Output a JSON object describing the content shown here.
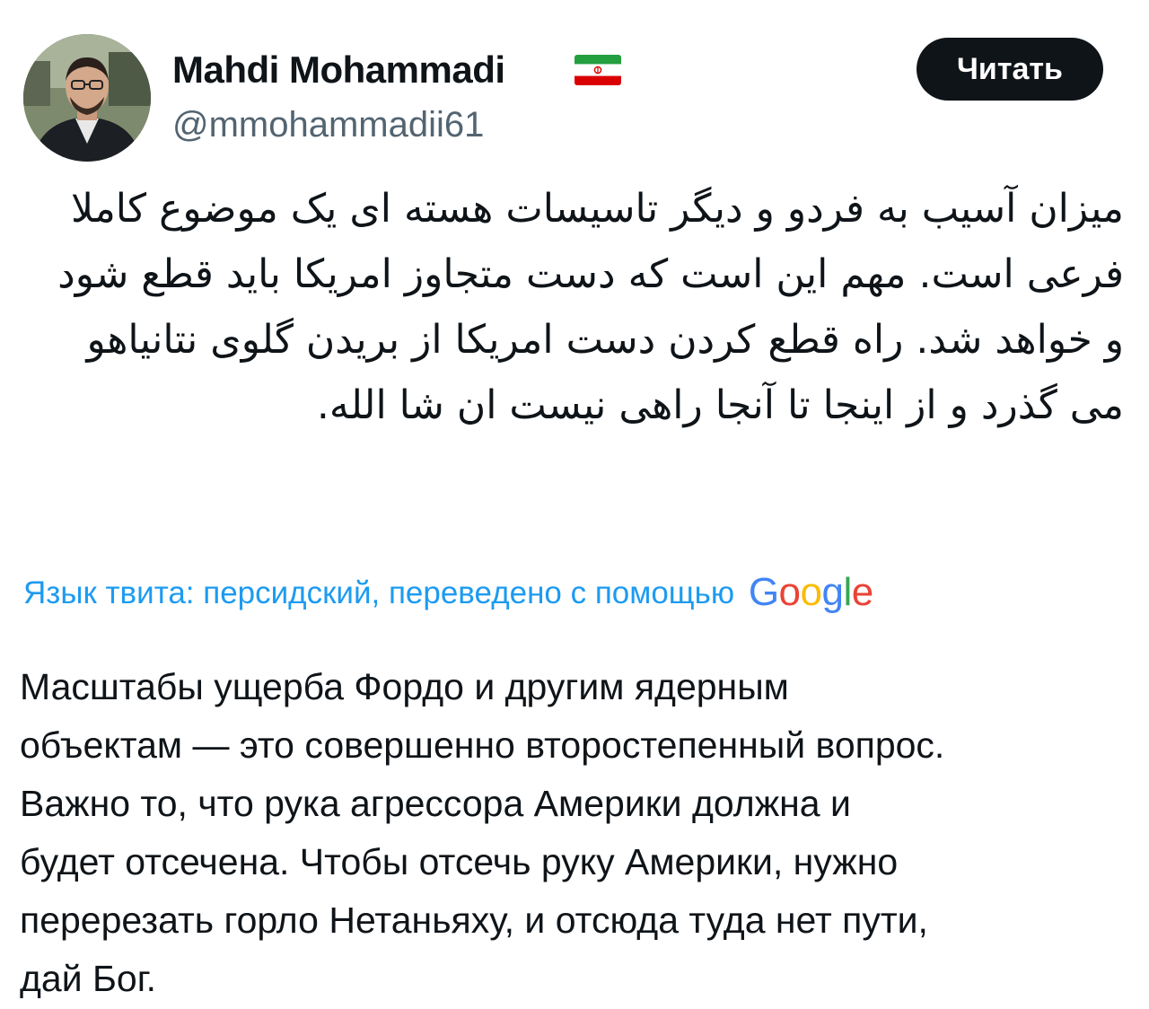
{
  "tweet": {
    "author": {
      "name": "Mahdi Mohammadi",
      "handle": "@mmohammadii61",
      "flag_icon": "iran-flag-icon",
      "avatar_icon": "user-avatar-photo"
    },
    "follow_button_label": "Читать",
    "original_text": "میزان آسیب به فردو و دیگر تاسیسات هسته ای یک موضوع کاملا فرعی است. مهم این است که دست متجاوز امریکا باید قطع شود و خواهد شد. راه قطع کردن دست امریکا از بریدن گلوی نتانیاهو می گذرد و از اینجا تا آنجا راهی نیست ان شا الله.",
    "translation_note": "Язык твита: персидский, переведено с помощью",
    "translation_provider": {
      "letters": [
        "G",
        "o",
        "o",
        "g",
        "l",
        "e"
      ]
    },
    "translated_lines": [
      "Масштабы ущерба Фордо и другим ядерным",
      "объектам — это совершенно второстепенный вопрос.",
      "Важно то, что рука агрессора Америки должна и",
      "будет отсечена. Чтобы отсечь руку Америки, нужно",
      "перерезать горло Нетаньяху, и отсюда туда нет пути,",
      "дай Бог."
    ]
  },
  "colors": {
    "text_primary": "#0f1419",
    "text_secondary": "#536471",
    "link": "#1d9bf0",
    "button_bg": "#0f1419",
    "button_text": "#ffffff"
  }
}
